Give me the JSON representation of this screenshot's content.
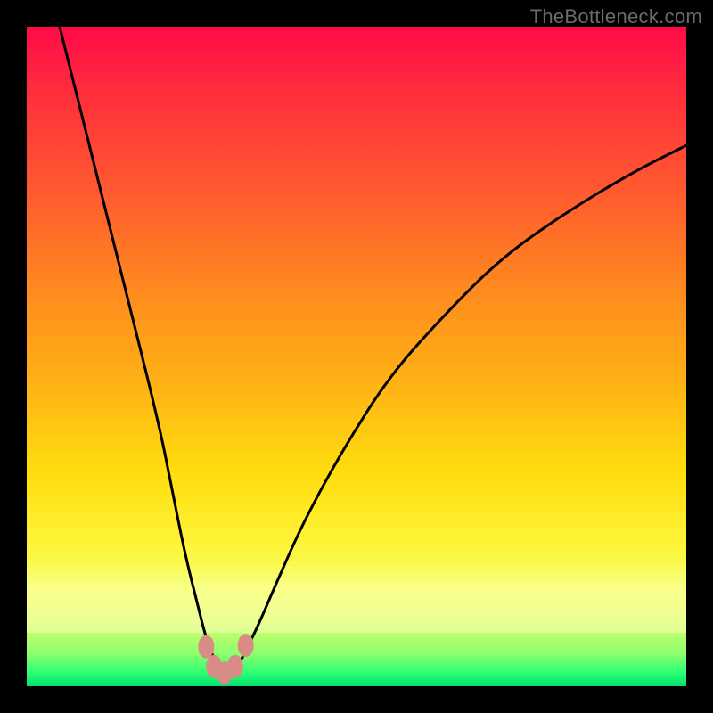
{
  "watermark": "TheBottleneck.com",
  "chart_data": {
    "type": "line",
    "title": "",
    "xlabel": "",
    "ylabel": "",
    "xlim": [
      0,
      100
    ],
    "ylim": [
      0,
      100
    ],
    "grid": false,
    "legend": false,
    "series": [
      {
        "name": "bottleneck-curve",
        "x": [
          5,
          10,
          15,
          20,
          22,
          24,
          26,
          27,
          28,
          29,
          30,
          31,
          32,
          33,
          35,
          38,
          42,
          48,
          55,
          63,
          72,
          82,
          92,
          100
        ],
        "y": [
          100,
          80,
          60,
          40,
          30,
          20,
          12,
          8,
          5,
          3,
          2,
          2,
          3,
          5,
          9,
          16,
          25,
          36,
          47,
          56,
          65,
          72,
          78,
          82
        ]
      }
    ],
    "markers": [
      {
        "name": "trough-pt-1",
        "x": 27.2,
        "y": 6.0,
        "color": "#d98b86"
      },
      {
        "name": "trough-pt-2",
        "x": 28.4,
        "y": 3.0,
        "color": "#d98b86"
      },
      {
        "name": "trough-pt-3",
        "x": 30.0,
        "y": 2.0,
        "color": "#d98b86"
      },
      {
        "name": "trough-pt-4",
        "x": 31.6,
        "y": 3.0,
        "color": "#d98b86"
      },
      {
        "name": "trough-pt-5",
        "x": 33.2,
        "y": 6.2,
        "color": "#d98b86"
      }
    ],
    "background_gradient": {
      "top": "#ff0a48",
      "mid_upper": "#ff8a1f",
      "mid": "#ffde0f",
      "mid_lower": "#f4ff5c",
      "bottom": "#00e06f"
    }
  }
}
